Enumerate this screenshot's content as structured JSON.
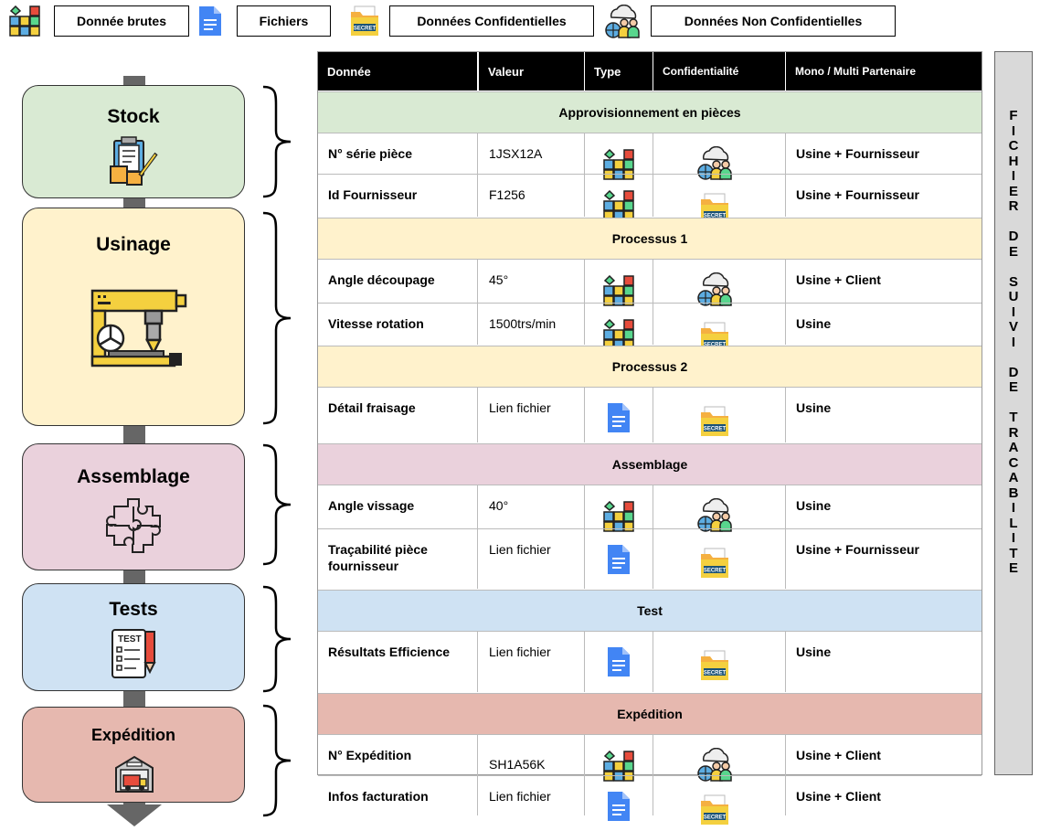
{
  "legend": {
    "raw": "Donnée brutes",
    "files": "Fichiers",
    "confidential": "Données Confidentielles",
    "nonconfidential": "Données Non Confidentielles"
  },
  "icons": {
    "raw": "data-blocks-icon",
    "file": "document-icon",
    "secret": "secret-folder-icon",
    "shared": "network-people-icon"
  },
  "colors": {
    "stock": "#d9ead3",
    "usinage": "#fff2cc",
    "assemblage": "#ead1dc",
    "tests": "#cfe2f3",
    "expedition": "#e6b8af",
    "header": "#000000",
    "sidebar": "#d9d9d9"
  },
  "stages": [
    {
      "title": "Stock",
      "icon": "clipboard-boxes-icon"
    },
    {
      "title": "Usinage",
      "icon": "milling-machine-icon"
    },
    {
      "title": "Assemblage",
      "icon": "puzzle-gear-icon"
    },
    {
      "title": "Tests",
      "icon": "test-sheet-icon"
    },
    {
      "title": "Expédition",
      "icon": "warehouse-truck-icon"
    }
  ],
  "table": {
    "headers": [
      "Donnée",
      "Valeur",
      "Type",
      "Confidentialité",
      "Mono / Multi Partenaire"
    ],
    "sections": [
      {
        "title": "Approvisionnement en pièces",
        "rows": [
          {
            "donnee": "N° série pièce",
            "valeur": "1JSX12A",
            "type": "raw",
            "conf": "shared",
            "partenaire": "Usine + Fournisseur"
          },
          {
            "donnee": "Id Fournisseur",
            "valeur": "F1256",
            "type": "raw",
            "conf": "secret",
            "partenaire": "Usine + Fournisseur"
          }
        ]
      },
      {
        "title": "Processus 1",
        "rows": [
          {
            "donnee": "Angle découpage",
            "valeur": "45°",
            "type": "raw",
            "conf": "shared",
            "partenaire": "Usine + Client"
          },
          {
            "donnee": "Vitesse rotation",
            "valeur": "1500trs/min",
            "type": "raw",
            "conf": "secret",
            "partenaire": "Usine"
          }
        ]
      },
      {
        "title": "Processus 2",
        "rows": [
          {
            "donnee": "Détail fraisage",
            "valeur": "Lien fichier",
            "type": "file",
            "conf": "secret",
            "partenaire": "Usine"
          }
        ]
      },
      {
        "title": "Assemblage",
        "rows": [
          {
            "donnee": "Angle vissage",
            "valeur": "40°",
            "type": "raw",
            "conf": "shared",
            "partenaire": "Usine"
          },
          {
            "donnee": "Traçabilité pièce fournisseur",
            "valeur": "Lien fichier",
            "type": "file",
            "conf": "secret",
            "partenaire": "Usine + Fournisseur"
          }
        ]
      },
      {
        "title": "Test",
        "rows": [
          {
            "donnee": "Résultats Efficience",
            "valeur": "Lien fichier",
            "type": "file",
            "conf": "secret",
            "partenaire": "Usine"
          }
        ]
      },
      {
        "title": "Expédition",
        "rows": [
          {
            "donnee": "N° Expédition",
            "valeur": "SH1A56K",
            "type": "raw",
            "conf": "shared",
            "partenaire": "Usine + Client"
          },
          {
            "donnee": "Infos facturation",
            "valeur": "Lien fichier",
            "type": "file",
            "conf": "secret",
            "partenaire": "Usine + Client"
          }
        ]
      }
    ]
  },
  "sidebar_title": "FICHIER DE SUIVI DE TRACABILITE"
}
